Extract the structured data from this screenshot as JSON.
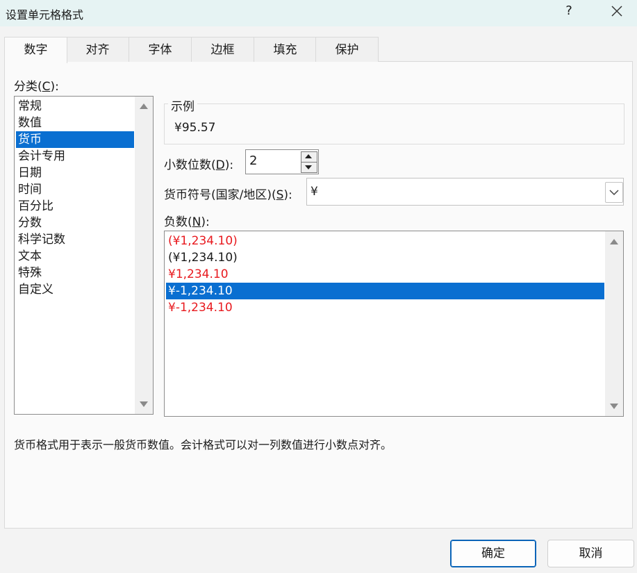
{
  "window": {
    "title": "设置单元格格式",
    "help": "?"
  },
  "tabs": [
    {
      "label": "数字",
      "active": true
    },
    {
      "label": "对齐"
    },
    {
      "label": "字体"
    },
    {
      "label": "边框"
    },
    {
      "label": "填充"
    },
    {
      "label": "保护"
    }
  ],
  "category": {
    "label_pre": "分类(",
    "label_key": "C",
    "label_post": "):",
    "items": [
      "常规",
      "数值",
      "货币",
      "会计专用",
      "日期",
      "时间",
      "百分比",
      "分数",
      "科学记数",
      "文本",
      "特殊",
      "自定义"
    ],
    "selected_index": 2
  },
  "sample": {
    "label": "示例",
    "value": "¥95.57"
  },
  "decimal": {
    "label_pre": "小数位数(",
    "label_key": "D",
    "label_post": "):",
    "value": "2"
  },
  "symbol": {
    "label_pre": "货币符号(国家/地区)(",
    "label_key": "S",
    "label_post": "):",
    "value": "¥"
  },
  "negative": {
    "label_pre": "负数(",
    "label_key": "N",
    "label_post": "):",
    "items": [
      {
        "text": "(¥1,234.10)",
        "color": "#e8191e"
      },
      {
        "text": "(¥1,234.10)",
        "color": "#1a1a1a"
      },
      {
        "text": "¥1,234.10",
        "color": "#e8191e"
      },
      {
        "text": "¥-1,234.10",
        "color": "#ffffff",
        "selected": true
      },
      {
        "text": "¥-1,234.10",
        "color": "#e8191e"
      }
    ]
  },
  "description": "货币格式用于表示一般货币数值。会计格式可以对一列数值进行小数点对齐。",
  "buttons": {
    "ok": "确定",
    "cancel": "取消"
  },
  "colors": {
    "selection": "#0a6fd1",
    "negative_red": "#e8191e",
    "titlebar": "#e6f3f3"
  }
}
